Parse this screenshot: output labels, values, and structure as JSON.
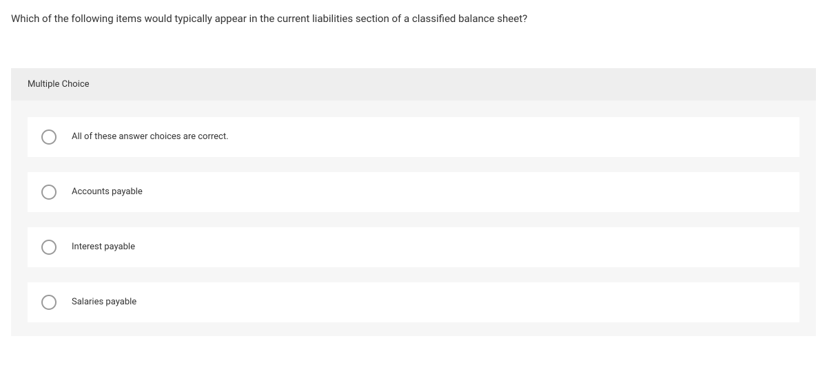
{
  "question": {
    "text": "Which of the following items would typically appear in the current liabilities section of a classified balance sheet?"
  },
  "section": {
    "header": "Multiple Choice"
  },
  "options": [
    {
      "label": "All of these answer choices are correct."
    },
    {
      "label": "Accounts payable"
    },
    {
      "label": "Interest payable"
    },
    {
      "label": "Salaries payable"
    }
  ]
}
